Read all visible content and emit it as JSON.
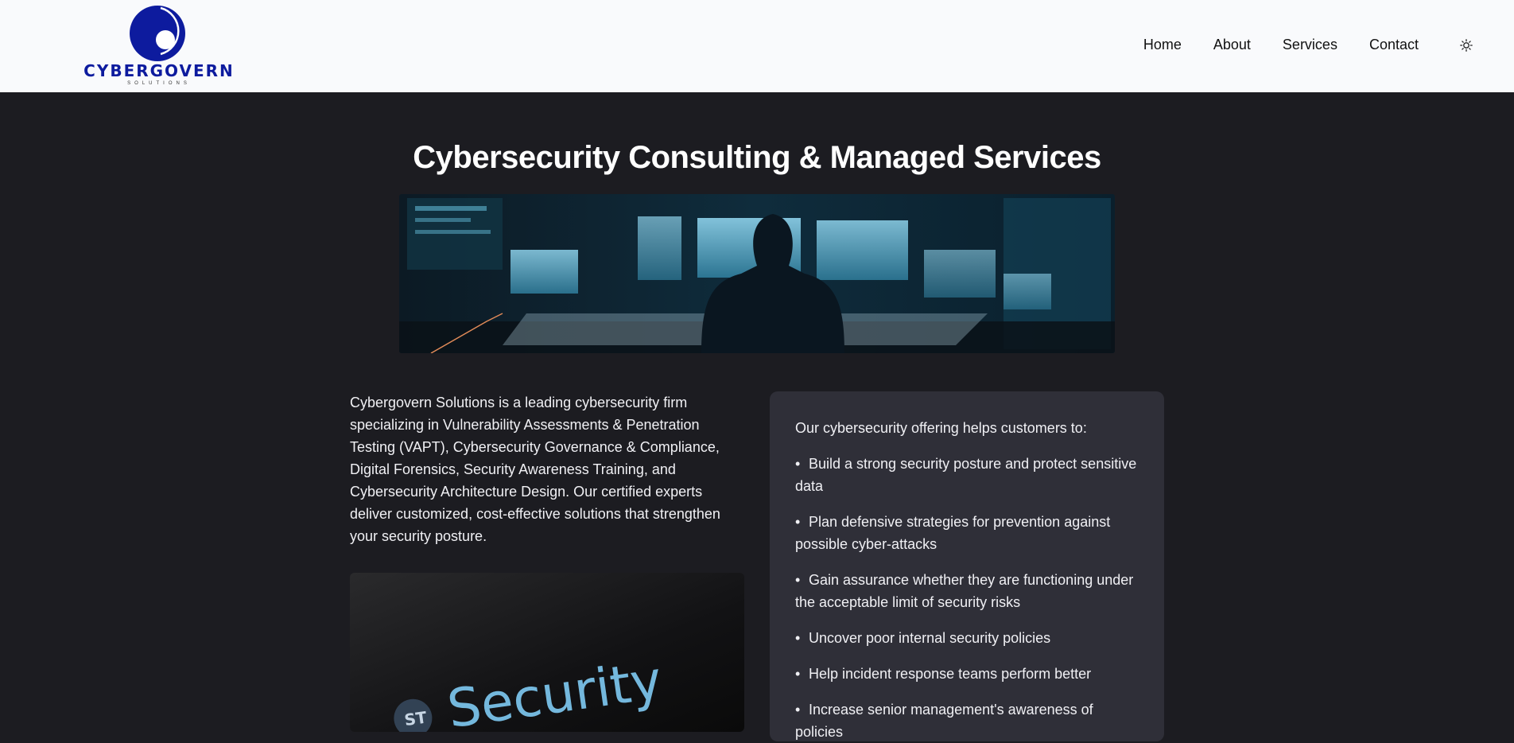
{
  "header": {
    "logo_text": "CYBERGOVERN",
    "logo_subtext": "SOLUTIONS",
    "nav": [
      "Home",
      "About",
      "Services",
      "Contact"
    ],
    "theme_toggle_icon": "sun-icon"
  },
  "hero": {
    "title": "Cybersecurity Consulting & Managed Services"
  },
  "intro": {
    "text": "Cybergovern Solutions is a leading cybersecurity firm specializing in Vulnerability Assessments & Penetration Testing (VAPT), Cybersecurity Governance & Compliance, Digital Forensics, Security Awareness Training, and Cybersecurity Architecture Design. Our certified experts deliver customized, cost-effective solutions that strengthen your security posture."
  },
  "security_image": {
    "text": "Security",
    "badge": "ST"
  },
  "offering": {
    "intro": "Our cybersecurity offering helps customers to:",
    "bullet": "•",
    "items": [
      "Build a strong security posture and protect sensitive data",
      "Plan defensive strategies for prevention against possible cyber-attacks",
      "Gain assurance whether they are functioning under the acceptable limit of security risks",
      "Uncover poor internal security policies",
      "Help incident response teams perform better",
      "Increase senior management's awareness of policies"
    ]
  },
  "colors": {
    "page_bg": "#1c1c21",
    "header_bg": "#f9fafc",
    "card_bg": "#2f2f38",
    "brand": "#0d1b9e"
  }
}
